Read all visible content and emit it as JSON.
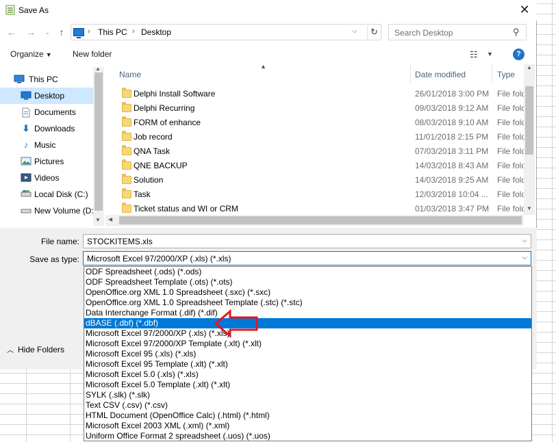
{
  "window": {
    "title": "Save As",
    "close_glyph": "✕"
  },
  "address_bar": {
    "crumbs": [
      "This PC",
      "Desktop"
    ],
    "separator": "›"
  },
  "search": {
    "placeholder": "Search Desktop"
  },
  "toolbar": {
    "organize": "Organize",
    "new_folder": "New folder",
    "help": "?"
  },
  "nav_pane": {
    "items": [
      {
        "label": "This PC",
        "icon": "computer-icon",
        "root": true,
        "selected": false
      },
      {
        "label": "Desktop",
        "icon": "desktop-icon",
        "root": false,
        "selected": true
      },
      {
        "label": "Documents",
        "icon": "documents-icon",
        "root": false,
        "selected": false
      },
      {
        "label": "Downloads",
        "icon": "downloads-icon",
        "root": false,
        "selected": false
      },
      {
        "label": "Music",
        "icon": "music-icon",
        "root": false,
        "selected": false
      },
      {
        "label": "Pictures",
        "icon": "pictures-icon",
        "root": false,
        "selected": false
      },
      {
        "label": "Videos",
        "icon": "videos-icon",
        "root": false,
        "selected": false
      },
      {
        "label": "Local Disk (C:)",
        "icon": "drive-icon",
        "root": false,
        "selected": false
      },
      {
        "label": "New Volume (D:",
        "icon": "drive-icon",
        "root": false,
        "selected": false
      }
    ]
  },
  "file_list": {
    "columns": {
      "name": "Name",
      "date": "Date modified",
      "type": "Type"
    },
    "rows": [
      {
        "name": "Delphi Install Software",
        "date": "26/01/2018 3:00 PM",
        "type": "File folder"
      },
      {
        "name": "Delphi Recurring",
        "date": "09/03/2018 9:12 AM",
        "type": "File folder"
      },
      {
        "name": "FORM of enhance",
        "date": "08/03/2018 9:10 AM",
        "type": "File folder"
      },
      {
        "name": "Job record",
        "date": "11/01/2018 2:15 PM",
        "type": "File folder"
      },
      {
        "name": "QNA Task",
        "date": "07/03/2018 3:11 PM",
        "type": "File folder"
      },
      {
        "name": "QNE BACKUP",
        "date": "14/03/2018 8:43 AM",
        "type": "File folder"
      },
      {
        "name": "Solution",
        "date": "14/03/2018 9:25 AM",
        "type": "File folder"
      },
      {
        "name": "Task",
        "date": "12/03/2018 10:04 ...",
        "type": "File folder"
      },
      {
        "name": "Ticket status and WI or CRM",
        "date": "01/03/2018 3:47 PM",
        "type": "File folder"
      }
    ]
  },
  "form": {
    "file_name_label": "File name:",
    "file_name_value": "STOCKITEMS.xls",
    "save_type_label": "Save as type:",
    "save_type_value": "Microsoft Excel 97/2000/XP (.xls) (*.xls)",
    "hide_folders": "Hide Folders"
  },
  "save_type_options": [
    "ODF Spreadsheet (.ods) (*.ods)",
    "ODF Spreadsheet Template (.ots) (*.ots)",
    "OpenOffice.org XML 1.0 Spreadsheet (.sxc) (*.sxc)",
    "OpenOffice.org XML 1.0 Spreadsheet Template (.stc) (*.stc)",
    "Data Interchange Format (.dif) (*.dif)",
    "dBASE (.dbf) (*.dbf)",
    "Microsoft Excel 97/2000/XP (.xls) (*.xls)",
    "Microsoft Excel 97/2000/XP Template (.xlt) (*.xlt)",
    "Microsoft Excel 95 (.xls) (*.xls)",
    "Microsoft Excel 95 Template (.xlt) (*.xlt)",
    "Microsoft Excel 5.0 (.xls) (*.xls)",
    "Microsoft Excel 5.0 Template (.xlt) (*.xlt)",
    "SYLK (.slk) (*.slk)",
    "Text CSV (.csv) (*.csv)",
    "HTML Document (OpenOffice Calc) (.html) (*.html)",
    "Microsoft Excel 2003 XML (.xml) (*.xml)",
    "Uniform Office Format 2 spreadsheet (.uos) (*.uos)"
  ],
  "selected_option_index": 5,
  "colors": {
    "selection_blue": "#0078d7",
    "nav_selected": "#cde8ff",
    "annotation_red": "#e8141c"
  }
}
